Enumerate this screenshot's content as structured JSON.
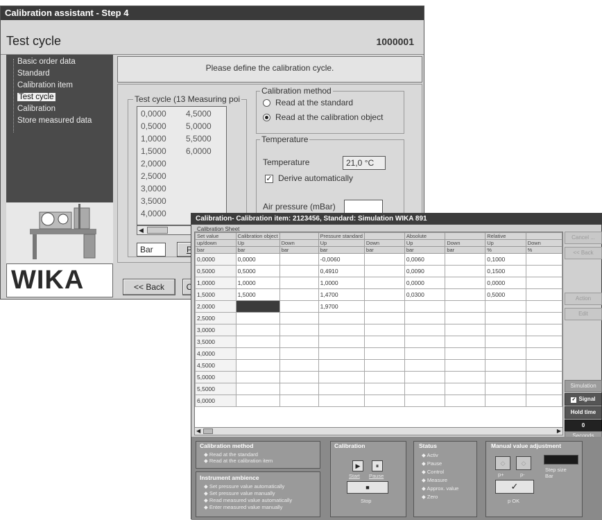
{
  "wizard": {
    "window_title": "Calibration assistant - Step 4",
    "page_title": "Test cycle",
    "order_number": "1000001",
    "nav_items": [
      "Basic order data",
      "Standard",
      "Calibration item",
      "Test cycle",
      "Calibration",
      "Store measured data"
    ],
    "selected_nav": "Test cycle",
    "logo_text": "WIKA",
    "instruction": "Please define the calibration cycle.",
    "test_cycle_group_label": "Test cycle (13 Measuring poi",
    "test_cycle_col1": [
      "0,0000",
      "0,5000",
      "1,0000",
      "1,5000",
      "2,0000",
      "2,5000",
      "3,0000",
      "3,5000",
      "4,0000"
    ],
    "test_cycle_col2": [
      "4,5000",
      "5,0000",
      "5,5000",
      "6,0000"
    ],
    "unit_value": "Bar",
    "unit_button_partial": "Pr",
    "calibration_method_label": "Calibration method",
    "method_option_standard": "Read at the standard",
    "method_option_object": "Read at the calibration object",
    "temperature_group_label": "Temperature",
    "temperature_label": "Temperature",
    "temperature_value": "21,0 °C",
    "derive_label": "Derive automatically",
    "air_pressure_label": "Air pressure (mBar)",
    "back_button": "<< Back",
    "partial_button": "C"
  },
  "calib": {
    "window_title": "Calibration- Calibration item: 2123456, Standard: Simulation WIKA 891",
    "sheet_label": "Calibration Sheet",
    "header_row1": [
      "Set value",
      "Calibration object",
      "",
      "Pressure standard",
      "",
      "Absolute",
      "",
      "Relative",
      ""
    ],
    "header_row2": [
      "up/down",
      "Up",
      "Down",
      "Up",
      "Down",
      "Up",
      "Down",
      "Up",
      "Down"
    ],
    "header_row3": [
      "bar",
      "bar",
      "bar",
      "bar",
      "bar",
      "bar",
      "bar",
      "%",
      "%"
    ],
    "rows": [
      [
        "0,0000",
        "0,0000",
        "",
        "-0,0060",
        "",
        "0,0060",
        "",
        "0,1000",
        ""
      ],
      [
        "0,5000",
        "0,5000",
        "",
        "0,4910",
        "",
        "0,0090",
        "",
        "0,1500",
        ""
      ],
      [
        "1,0000",
        "1,0000",
        "",
        "1,0000",
        "",
        "0,0000",
        "",
        "0,0000",
        ""
      ],
      [
        "1,5000",
        "1,5000",
        "",
        "1,4700",
        "",
        "0,0300",
        "",
        "0,5000",
        ""
      ],
      [
        "2,0000",
        "",
        "",
        "1,9700",
        "",
        "",
        "",
        "",
        ""
      ],
      [
        "2,5000",
        "",
        "",
        "",
        "",
        "",
        "",
        "",
        ""
      ],
      [
        "3,0000",
        "",
        "",
        "",
        "",
        "",
        "",
        "",
        ""
      ],
      [
        "3,5000",
        "",
        "",
        "",
        "",
        "",
        "",
        "",
        ""
      ],
      [
        "4,0000",
        "",
        "",
        "",
        "",
        "",
        "",
        "",
        ""
      ],
      [
        "4,5000",
        "",
        "",
        "",
        "",
        "",
        "",
        "",
        ""
      ],
      [
        "5,0000",
        "",
        "",
        "",
        "",
        "",
        "",
        "",
        ""
      ],
      [
        "5,5000",
        "",
        "",
        "",
        "",
        "",
        "",
        "",
        ""
      ],
      [
        "6,0000",
        "",
        "",
        "",
        "",
        "",
        "",
        "",
        ""
      ]
    ],
    "side_buttons": [
      "Cancel ...",
      "<< Back",
      "Action",
      "Edit"
    ],
    "simulation_label": "Simulation",
    "signal_label": "Signal",
    "hold_time_label": "Hold time",
    "hold_time_value": "0",
    "seconds_label": "Seconds",
    "method_box": {
      "title": "Calibration method",
      "items": [
        "Read at the standard",
        "Read at the calibration item"
      ]
    },
    "ambience_box": {
      "title": "Instrument ambience",
      "items": [
        "Set pressure value automatically",
        "Set pressure value manually",
        "Read measured value automatically",
        "Enter measured value manually"
      ]
    },
    "calibration_box": {
      "title": "Calibration",
      "start": "Start",
      "pause": "Pause",
      "stop": "Stop"
    },
    "status_box": {
      "title": "Status",
      "items": [
        "Activ",
        "Pause",
        "Control",
        "Measure",
        "Approx. value",
        "Zero"
      ]
    },
    "manual_box": {
      "title": "Manual value adjustment",
      "p_plus": "p+",
      "p_minus": "p-",
      "step_size": "Step size",
      "step_unit": "Bar",
      "ok": "p OK",
      "check": "✓"
    }
  }
}
